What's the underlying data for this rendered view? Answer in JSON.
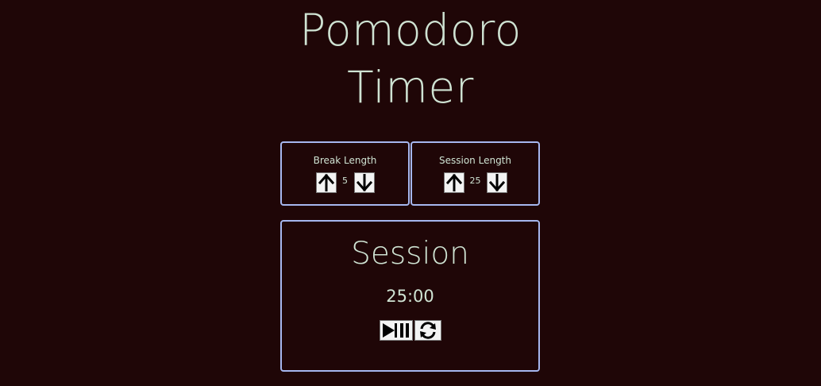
{
  "header": {
    "title_line1": "Pomodoro",
    "title_line2": "Timer"
  },
  "break": {
    "label": "Break Length",
    "value": "5",
    "increment_icon": "arrow-up-icon",
    "decrement_icon": "arrow-down-icon"
  },
  "session": {
    "label": "Session Length",
    "value": "25",
    "increment_icon": "arrow-up-icon",
    "decrement_icon": "arrow-down-icon"
  },
  "timer": {
    "label": "Session",
    "time_left": "25:00",
    "start_stop_icon": "play-pause-icon",
    "reset_icon": "refresh-icon"
  },
  "colors": {
    "background": "#1f0607",
    "text": "#cfe3d3",
    "border": "#a6b7ef",
    "button_bg": "#f3f3f3"
  }
}
